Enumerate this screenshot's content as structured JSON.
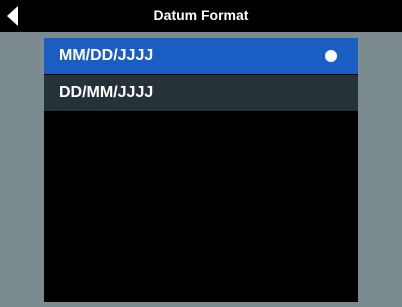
{
  "header": {
    "title": "Datum Format",
    "back_icon": "back-arrow-icon"
  },
  "options": [
    {
      "label": "MM/DD/JJJJ",
      "selected": true
    },
    {
      "label": "DD/MM/JJJJ",
      "selected": false
    }
  ],
  "colors": {
    "background": "#7b8b8f",
    "header": "#000000",
    "selected_row": "#1a5ec4",
    "unselected_row": "#253238",
    "list_panel": "#000000",
    "text": "#ffffff"
  }
}
